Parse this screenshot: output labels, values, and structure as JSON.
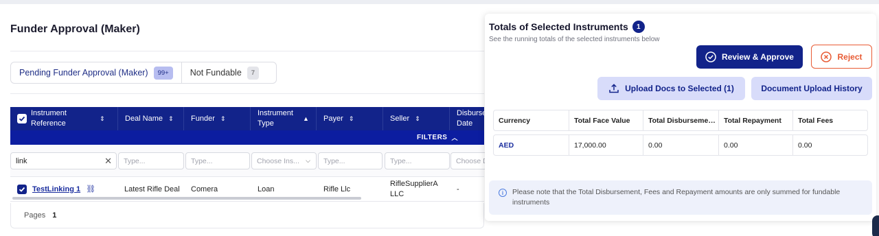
{
  "page": {
    "title": "Funder Approval (Maker)"
  },
  "tabs": [
    {
      "label": "Pending Funder Approval (Maker)",
      "count": "99+"
    },
    {
      "label": "Not Fundable",
      "count": "7"
    }
  ],
  "table": {
    "columns": {
      "instrument_reference": "Instrument Reference",
      "deal_name": "Deal Name",
      "funder": "Funder",
      "instrument_type": "Instrument Type",
      "payer": "Payer",
      "seller": "Seller",
      "disbursement_date": "Disburse Date"
    },
    "filters_label": "FILTERS",
    "filters": {
      "instrument_reference": "link",
      "deal_name": "Type...",
      "funder": "Type...",
      "instrument_type": "Choose Ins...",
      "payer": "Type...",
      "seller": "Type...",
      "disbursement_date": "Choose D"
    },
    "rows": [
      {
        "instrument_reference": "TestLinking 1",
        "deal_name": "Latest Rifle Deal",
        "funder": "Comera",
        "instrument_type": "Loan",
        "payer": "Rifle Llc",
        "seller": "RifleSupplierA LLC",
        "disbursement_date": "-"
      }
    ],
    "pages_label": "Pages",
    "page_number": "1"
  },
  "panel": {
    "title": "Totals of Selected Instruments",
    "badge": "1",
    "subtitle": "See the running totals of the selected instruments below",
    "buttons": {
      "approve": "Review & Approve",
      "reject": "Reject",
      "upload": "Upload Docs to Selected (1)",
      "history": "Document Upload History"
    },
    "summary": {
      "headers": [
        "Currency",
        "Total Face Value",
        "Total Disburseme…",
        "Total Repayment",
        "Total Fees"
      ],
      "row": [
        "AED",
        "17,000.00",
        "0.00",
        "0.00",
        "0.00"
      ]
    },
    "note": "Please note that the Total Disbursement, Fees and Repayment amounts are only summed for fundable instruments"
  },
  "colors": {
    "primary": "#12238a",
    "reject": "#e85a33",
    "light_button": "#d8dcfa"
  }
}
